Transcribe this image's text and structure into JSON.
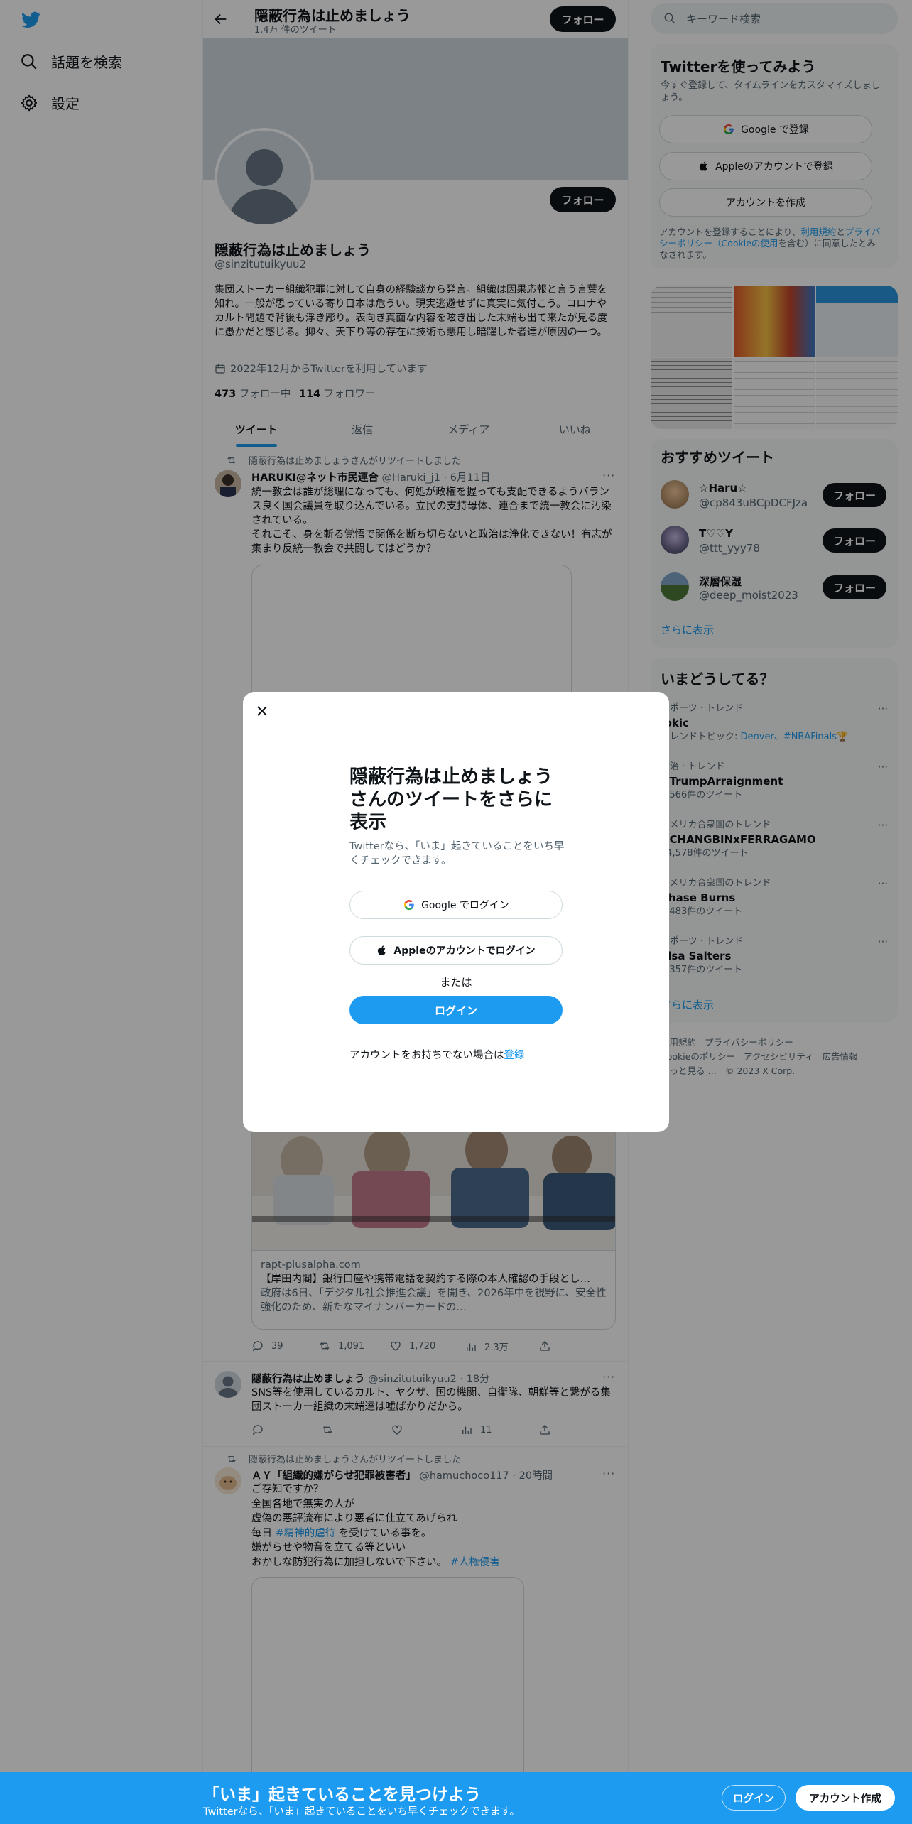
{
  "nav": {
    "explore_label": "話題を検索",
    "settings_label": "設定"
  },
  "header": {
    "name": "隠蔽行為は止めましょう",
    "tweet_count": "1.4万 件のツイート",
    "follow_label": "フォロー"
  },
  "profile": {
    "name": "隠蔽行為は止めましょう",
    "handle": "@sinzitutuikyuu2",
    "bio": "集団ストーカー組織犯罪に対して自身の経験談から発言。組織は因果応報と言う言葉を知れ。一般が思っている寄り日本は危うい。現実逃避せずに真実に気付こう。コロナやカルト問題で背後も浮き彫り。表向き真面な内容を呟き出した末端も出て来たが見る度に愚かだと感じる。抑々、天下り等の存在に技術も悪用し暗躍した者達が原因の一つ。",
    "joined": "2022年12月からTwitterを利用しています",
    "following_count": "473",
    "following_label": "フォロー中",
    "followers_count": "114",
    "followers_label": "フォロワー",
    "follow_label": "フォロー"
  },
  "tabs": [
    "ツイート",
    "返信",
    "メディア",
    "いいね"
  ],
  "tweets": [
    {
      "retweet_note": "隠蔽行為は止めましょうさんがリツイートしました",
      "name": "HARUKI@ネット市民連合",
      "handle": "@Haruki_j1",
      "time": "· 6月11日",
      "text1": "統一教会は誰が総理になっても、何処が政権を握っても支配できるようバランス良く国会議員を取り込んでいる。立民の支持母体、連合まで統一教会に汚染されている。",
      "text2": "それこそ、身を斬る覚悟で関係を断ち切らないと政治は浄化できない！有志が集まり反統一教会で共闘してはどうか？"
    },
    {
      "card_domain": "rapt-plusalpha.com",
      "card_title": "【岸田内閣】銀行口座や携帯電話を契約する際の本人確認の手段とし…",
      "card_desc": "政府は6日、「デジタル社会推進会議」を開き、2026年中を視野に、安全性強化のため、新たなマイナンバーカードの…",
      "replies": "39",
      "retweets": "1,091",
      "likes": "1,720",
      "views": "2.3万"
    },
    {
      "name": "隠蔽行為は止めましょう",
      "handle": "@sinzitutuikyuu2",
      "time": "· 18分",
      "text": "SNS等を使用しているカルト、ヤクザ、国の機関、自衛隊、朝鮮等と繋がる集団ストーカー組織の末端達は嘘ばかりだから。",
      "views": "11"
    },
    {
      "retweet_note": "隠蔽行為は止めましょうさんがリツイートしました",
      "name": "ＡＹ「組織的嫌がらせ犯罪被害者」",
      "handle": "@hamuchoco117",
      "time": "· 20時間",
      "line1": "ご存知ですか？",
      "line2": "全国各地で無実の人が",
      "line3": "虚偽の悪評流布により悪者に仕立てあげられ",
      "line4_pre": "毎日 ",
      "line4_tag": "#精神的虐待",
      "line4_post": " を受けている事を。",
      "line5": "嫌がらせや物音を立てる等といい",
      "line6_pre": "おかしな防犯行為に加担しないで下さい。 ",
      "line6_tag": "#人権侵害"
    }
  ],
  "search": {
    "placeholder": "キーワード検索"
  },
  "signup": {
    "title": "Twitterを使ってみよう",
    "subtitle": "今すぐ登録して、タイムラインをカスタマイズしましょう。",
    "google": "Google で登録",
    "apple": "Appleのアカウントで登録",
    "create": "アカウントを作成",
    "terms_pre": "アカウントを登録することにより、",
    "terms_link1": "利用規約",
    "terms_mid": "と",
    "terms_link2": "プライバシーポリシー（Cookieの使用",
    "terms_post": "を含む）に同意したとみなされます。"
  },
  "recommended": {
    "title": "おすすめツイート",
    "follow_label": "フォロー",
    "show_more": "さらに表示",
    "users": [
      {
        "name": "☆Haru☆",
        "handle": "@cp843uBCpDCFJza"
      },
      {
        "name": "T♡♡Y",
        "handle": "@ttt_yyy78"
      },
      {
        "name": "深層保湿",
        "handle": "@deep_moist2023"
      }
    ]
  },
  "trends": {
    "title": "いまどうしてる？",
    "show_more": "さらに表示",
    "items": [
      {
        "context": "スポーツ · トレンド",
        "name": "Jokic",
        "extra_pre": "トレンドトピック: ",
        "extra_links": "Denver、#NBAFinals",
        "extra_emoji": "🏆"
      },
      {
        "context": "政治 · トレンド",
        "name": "#TrumpArraignment",
        "extra": "2,566件のツイート"
      },
      {
        "context": "アメリカ合衆国のトレンド",
        "name": "#CHANGBINxFERRAGAMO",
        "extra": "54,578件のツイート"
      },
      {
        "context": "アメリカ合衆国のトレンド",
        "name": "Chase Burns",
        "extra": "1,483件のツイート"
      },
      {
        "context": "スポーツ · トレンド",
        "name": "Elsa Salters",
        "extra": "1,357件のツイート"
      }
    ]
  },
  "footer": {
    "links1": [
      "利用規約",
      "プライバシーポリシー"
    ],
    "links2": [
      "Cookieのポリシー",
      "アクセシビリティ",
      "広告情報"
    ],
    "more": "もっと見る …",
    "copyright": "© 2023 X Corp."
  },
  "modal": {
    "title": "隠蔽行為は止めましょうさんのツイートをさらに表示",
    "subtitle": "Twitterなら、「いま」起きていることをいち早くチェックできます。",
    "google": "Google でログイン",
    "apple": "Appleのアカウントでログイン",
    "or": "または",
    "login": "ログイン",
    "no_account": "アカウントをお持ちでない場合は",
    "signup": "登録"
  },
  "bottom_bar": {
    "title": "「いま」起きていることを見つけよう",
    "subtitle": "Twitterなら、「いま」起きていることをいち早くチェックできます。",
    "login": "ログイン",
    "signup": "アカウント作成"
  }
}
